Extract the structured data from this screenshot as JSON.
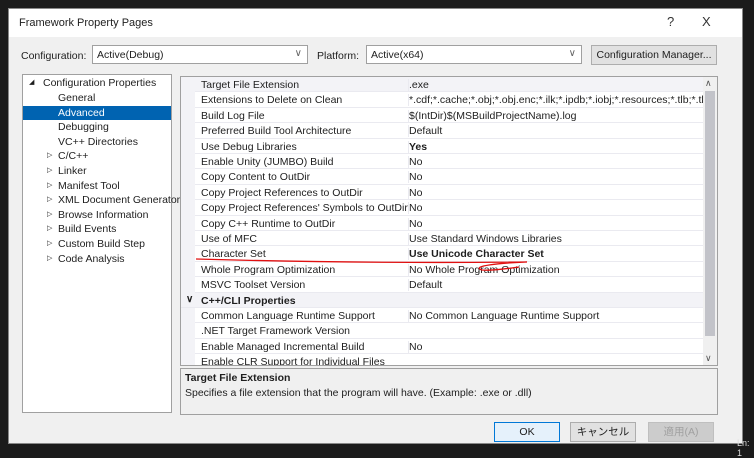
{
  "window": {
    "title": "Framework Property Pages",
    "help": "?",
    "close": "X"
  },
  "config": {
    "config_label": "Configuration:",
    "config_value": "Active(Debug)",
    "platform_label": "Platform:",
    "platform_value": "Active(x64)",
    "manager_button": "Configuration Manager..."
  },
  "tree": {
    "root": "Configuration Properties",
    "items": [
      {
        "label": "General",
        "expandable": false
      },
      {
        "label": "Advanced",
        "expandable": false,
        "selected": true
      },
      {
        "label": "Debugging",
        "expandable": false
      },
      {
        "label": "VC++ Directories",
        "expandable": false
      },
      {
        "label": "C/C++",
        "expandable": true
      },
      {
        "label": "Linker",
        "expandable": true
      },
      {
        "label": "Manifest Tool",
        "expandable": true
      },
      {
        "label": "XML Document Generator",
        "expandable": true
      },
      {
        "label": "Browse Information",
        "expandable": true
      },
      {
        "label": "Build Events",
        "expandable": true
      },
      {
        "label": "Custom Build Step",
        "expandable": true
      },
      {
        "label": "Code Analysis",
        "expandable": true
      }
    ]
  },
  "grid": {
    "rows": [
      {
        "name": "Target File Extension",
        "value": ".exe"
      },
      {
        "name": "Extensions to Delete on Clean",
        "value": "*.cdf;*.cache;*.obj;*.obj.enc;*.ilk;*.ipdb;*.iobj;*.resources;*.tlb;*.tli;*.tlh"
      },
      {
        "name": "Build Log File",
        "value": "$(IntDir)$(MSBuildProjectName).log"
      },
      {
        "name": "Preferred Build Tool Architecture",
        "value": "Default"
      },
      {
        "name": "Use Debug Libraries",
        "value": "Yes",
        "bold": true
      },
      {
        "name": "Enable Unity (JUMBO) Build",
        "value": "No"
      },
      {
        "name": "Copy Content to OutDir",
        "value": "No"
      },
      {
        "name": "Copy Project References to OutDir",
        "value": "No"
      },
      {
        "name": "Copy Project References' Symbols to OutDir",
        "value": "No"
      },
      {
        "name": "Copy C++ Runtime to OutDir",
        "value": "No"
      },
      {
        "name": "Use of MFC",
        "value": "Use Standard Windows Libraries"
      },
      {
        "name": "Character Set",
        "value": "Use Unicode Character Set",
        "bold": true
      },
      {
        "name": "Whole Program Optimization",
        "value": "No Whole Program Optimization"
      },
      {
        "name": "MSVC Toolset Version",
        "value": "Default"
      },
      {
        "category": "C++/CLI Properties"
      },
      {
        "name": "Common Language Runtime Support",
        "value": "No Common Language Runtime Support"
      },
      {
        "name": ".NET Target Framework Version",
        "value": ""
      },
      {
        "name": "Enable Managed Incremental Build",
        "value": "No"
      },
      {
        "name": "Enable CLR Support for Individual Files",
        "value": ""
      }
    ]
  },
  "description": {
    "title": "Target File Extension",
    "text": "Specifies a file extension that the program will have. (Example: .exe or .dll)"
  },
  "buttons": {
    "ok": "OK",
    "cancel": "キャンセル",
    "apply": "適用(A)"
  },
  "status": {
    "line": "Ln: 1"
  },
  "annotation_color": "#e01010"
}
